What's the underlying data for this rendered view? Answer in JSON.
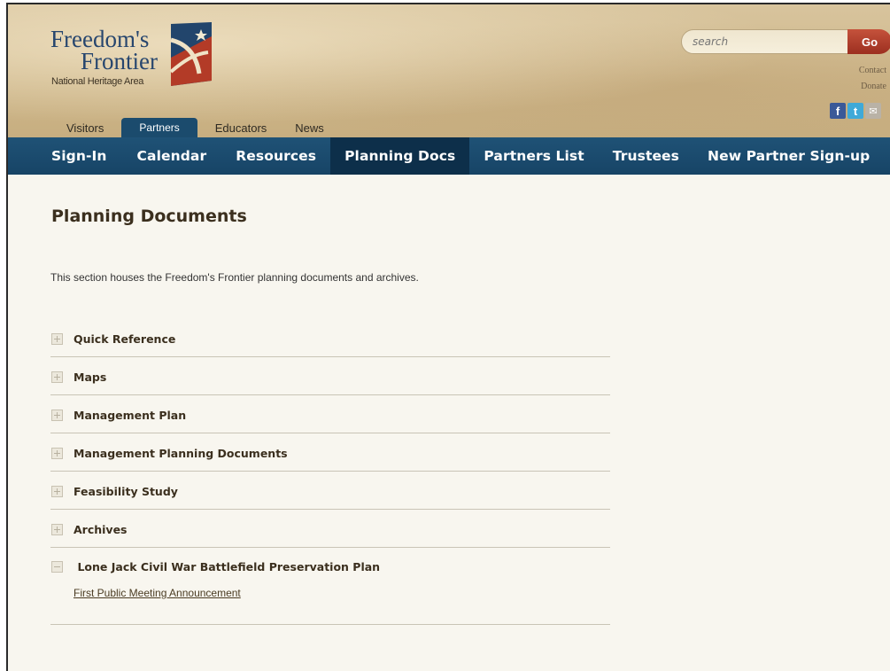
{
  "header": {
    "logo_line1": "Freedom's",
    "logo_line2": "Frontier",
    "logo_sub": "National Heritage Area",
    "search_placeholder": "search",
    "go_label": "Go",
    "contact_label": "Contact",
    "donate_label": "Donate",
    "social": [
      {
        "icon": "facebook-icon",
        "glyph": "f",
        "color": "#3b5998"
      },
      {
        "icon": "twitter-icon",
        "glyph": "t",
        "color": "#3fa9d8"
      },
      {
        "icon": "email-icon",
        "glyph": "✉",
        "color": "#b9b2a6"
      }
    ]
  },
  "audience_tabs": [
    {
      "label": "Visitors",
      "active": false
    },
    {
      "label": "Partners",
      "active": true
    },
    {
      "label": "Educators",
      "active": false
    },
    {
      "label": "News",
      "active": false
    }
  ],
  "nav": [
    {
      "label": "Sign-In",
      "active": false
    },
    {
      "label": "Calendar",
      "active": false
    },
    {
      "label": "Resources",
      "active": false
    },
    {
      "label": "Planning Docs",
      "active": true
    },
    {
      "label": "Partners List",
      "active": false
    },
    {
      "label": "Trustees",
      "active": false
    },
    {
      "label": "New Partner Sign-up",
      "active": false
    }
  ],
  "main": {
    "title": "Planning Documents",
    "intro": "This section houses the Freedom's Frontier planning documents and archives.",
    "items": [
      {
        "label": "Quick Reference",
        "expanded": false
      },
      {
        "label": "Maps",
        "expanded": false
      },
      {
        "label": "Management Plan",
        "expanded": false
      },
      {
        "label": "Management Planning Documents",
        "expanded": false
      },
      {
        "label": "Feasibility Study",
        "expanded": false
      },
      {
        "label": "Archives",
        "expanded": false
      },
      {
        "label": "Lone Jack Civil War Battlefield Preservation Plan",
        "expanded": true,
        "link": "First Public Meeting Announcement"
      }
    ]
  },
  "colors": {
    "nav_bg": "#1b4b6d",
    "nav_active": "#0d2f4a",
    "go_button": "#b2402c",
    "title_text": "#3b2f1e"
  }
}
